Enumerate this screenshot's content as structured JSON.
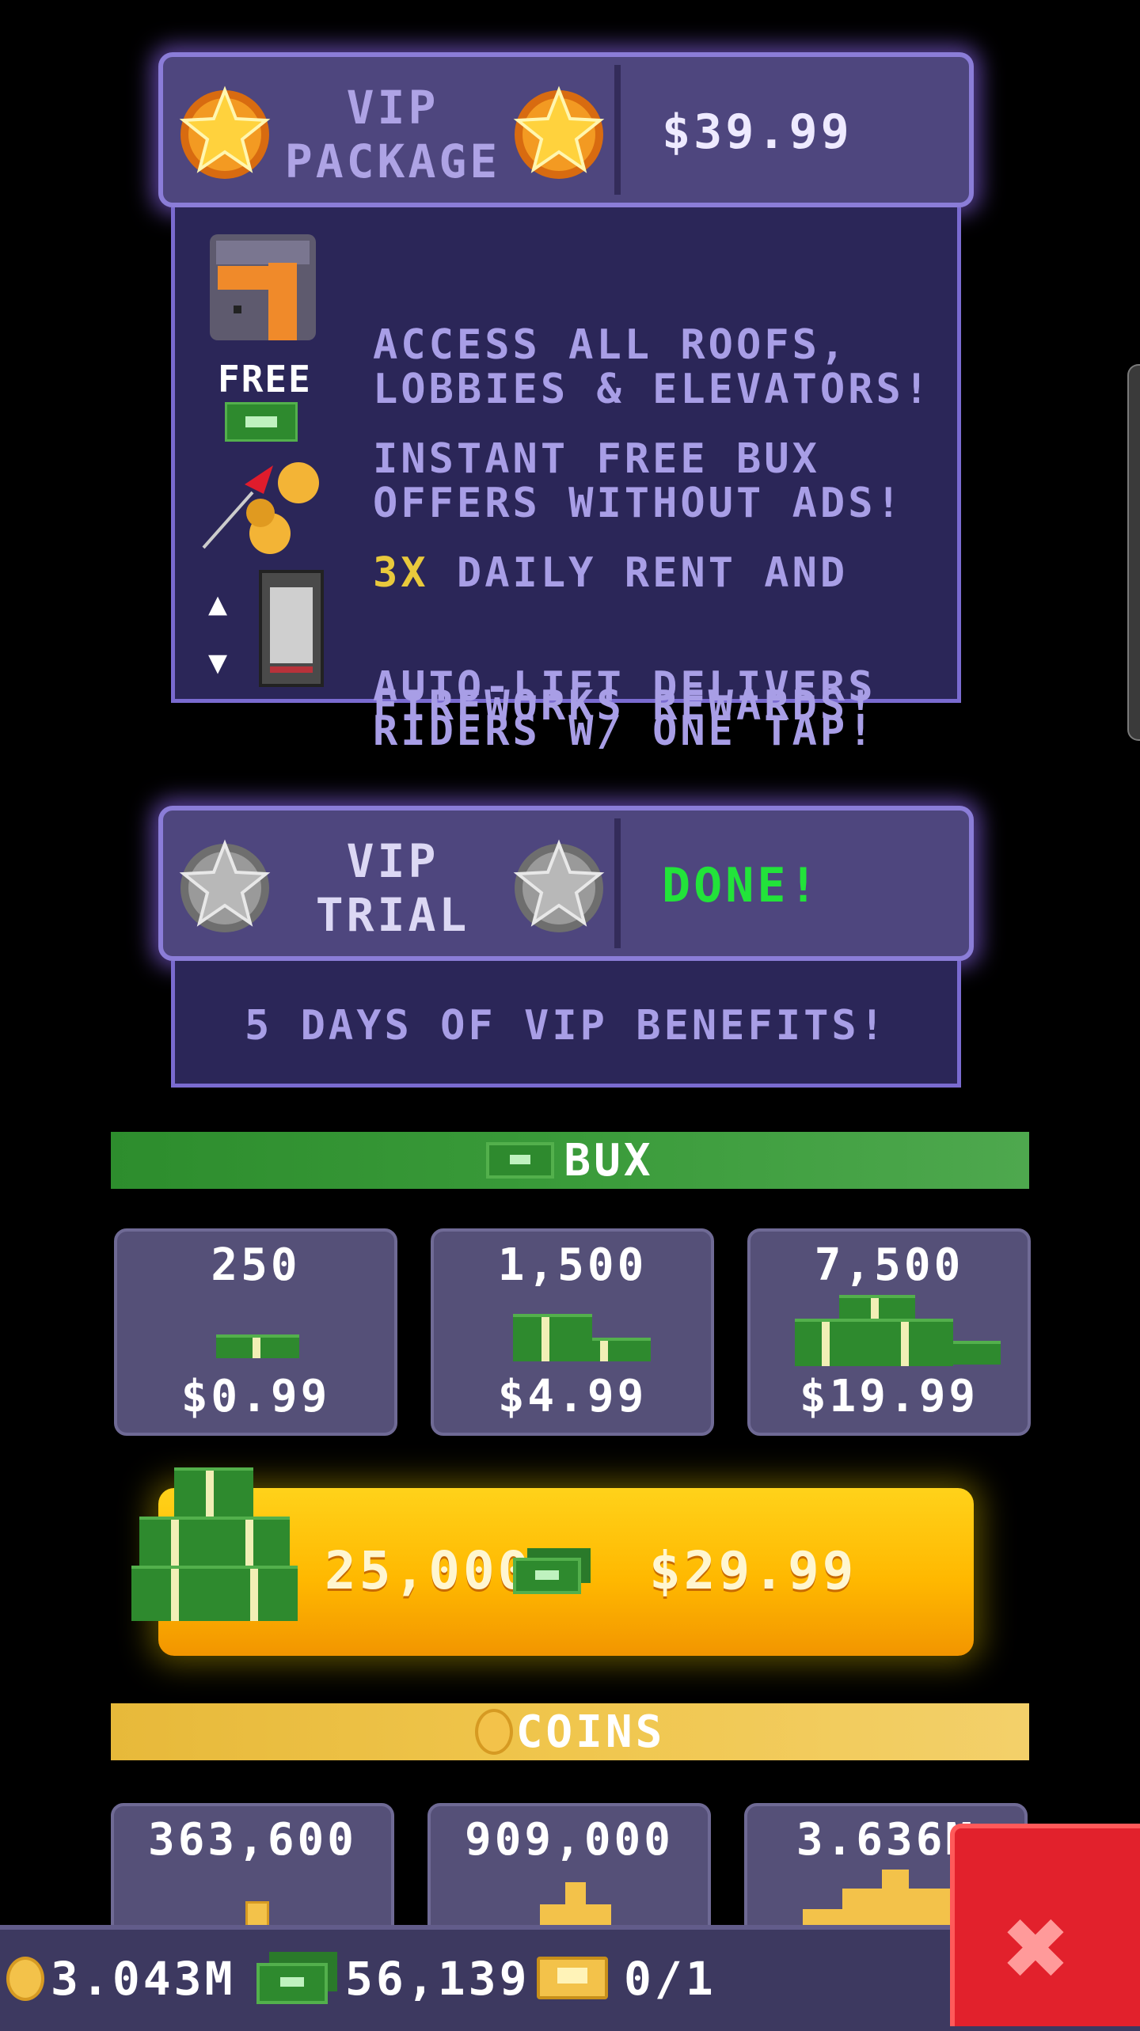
{
  "vip_package": {
    "name_line1": "VIP",
    "name_line2": "PACKAGE",
    "price": "$39.99",
    "benefits": [
      {
        "line1": "ACCESS ALL ROOFS,",
        "line2": "LOBBIES & ELEVATORS!",
        "icon": "room-icon"
      },
      {
        "line1": "INSTANT FREE BUX",
        "line2": "OFFERS WITHOUT ADS!",
        "icon": "free-bux-icon",
        "icon_label": "FREE"
      },
      {
        "line1_highlight": "3X",
        "line1": " DAILY RENT AND",
        "line2": "FIREWORKS REWARDS!",
        "icon": "fireworks-icon"
      },
      {
        "line1": "AUTO-LIFT DELIVERS",
        "line2": "RIDERS W/ ONE TAP!",
        "icon": "elevator-icon"
      }
    ]
  },
  "vip_trial": {
    "name_line1": "VIP",
    "name_line2": "TRIAL",
    "status": "DONE!",
    "description": "5 DAYS OF VIP BENEFITS!"
  },
  "bux_section": {
    "title": "BUX",
    "packs": [
      {
        "amount": "250",
        "price": "$0.99"
      },
      {
        "amount": "1,500",
        "price": "$4.99"
      },
      {
        "amount": "7,500",
        "price": "$19.99"
      }
    ],
    "big_pack": {
      "amount": "25,000",
      "price": "$29.99"
    }
  },
  "coins_section": {
    "title": "COINS",
    "packs": [
      {
        "amount": "363,600"
      },
      {
        "amount": "909,000"
      },
      {
        "amount": "3.636M"
      }
    ]
  },
  "status_bar": {
    "coins": "3.043M",
    "bux": "56,139",
    "tickets": "0/1"
  },
  "colors": {
    "vip_panel": "#4e467e",
    "vip_glow": "#966eff",
    "bux_green": "#3a9b3a",
    "coins_gold": "#f0c64d",
    "done_green": "#22e33a",
    "close_red": "#e2212c"
  }
}
